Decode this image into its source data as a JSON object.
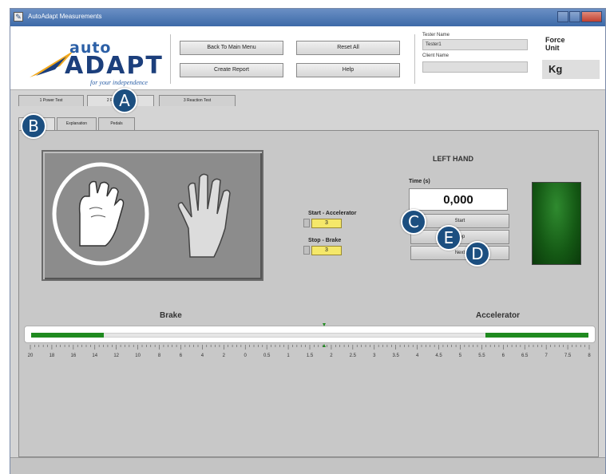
{
  "window": {
    "title": "AutoAdapt Measurements"
  },
  "logo": {
    "brand_top": "auto",
    "brand_main": "ADAPT",
    "tagline": "for your independence"
  },
  "header": {
    "buttons": [
      {
        "label": "Back To Main Menu"
      },
      {
        "label": "Reset All"
      },
      {
        "label": "Create Report"
      },
      {
        "label": "Help"
      }
    ],
    "tester_name_label": "Tester Name",
    "tester_name_value": "Tester1",
    "client_name_label": "Client Name",
    "client_name_value": "",
    "force_unit_label": "Force Unit",
    "force_unit_value": "Kg"
  },
  "main_tabs": [
    {
      "label": "1 Power Test"
    },
    {
      "label": "2 Reaction Test"
    },
    {
      "label": "3 Reaction Test"
    }
  ],
  "sub_tabs": [
    {
      "label": "Left"
    },
    {
      "label": "Explanation"
    },
    {
      "label": "Pedals"
    }
  ],
  "controls": {
    "start_label": "Start - Accelerator",
    "start_value": "3",
    "stop_label": "Stop - Brake",
    "stop_value": "3"
  },
  "test_panel": {
    "title": "LEFT HAND",
    "time_label": "Time (s)",
    "time_value": "0,000",
    "buttons": [
      {
        "label": "Start"
      },
      {
        "label": "Stop"
      },
      {
        "label": "Next"
      }
    ]
  },
  "brake_accel": {
    "brake_label": "Brake",
    "accelerator_label": "Accelerator",
    "brake_level": 0.26,
    "accelerator_level": 0.37,
    "scale": [
      "20",
      "18",
      "16",
      "14",
      "12",
      "10",
      "8",
      "6",
      "4",
      "2",
      "0",
      "0.5",
      "1",
      "1.5",
      "2",
      "2.5",
      "3",
      "3.5",
      "4",
      "4.5",
      "5",
      "5.5",
      "6",
      "6.5",
      "7",
      "7.5",
      "8"
    ]
  },
  "callouts": [
    "A",
    "B",
    "C",
    "D",
    "E"
  ],
  "colors": {
    "accent": "#1c4f80",
    "indicator_green": "#1f8a1f",
    "value_yellow": "#f5e86a"
  }
}
